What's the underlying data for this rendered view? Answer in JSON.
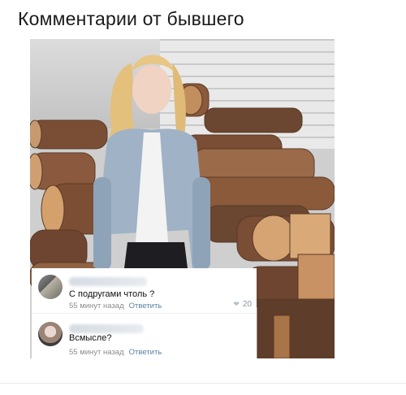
{
  "header": {
    "title": "Комментарии от бывшего"
  },
  "post": {
    "image_icon": "photo-girl-with-logs"
  },
  "comments": [
    {
      "text": "С подругами чтоль ?",
      "time": "55 минут назад",
      "reply_label": "Ответить",
      "likes": "20"
    },
    {
      "text": "Всмысле?",
      "time": "55 минут назад",
      "reply_label": "Ответить"
    }
  ],
  "colors": {
    "reply_link": "#5c7fa6",
    "meta_text": "#8c8c8c"
  }
}
